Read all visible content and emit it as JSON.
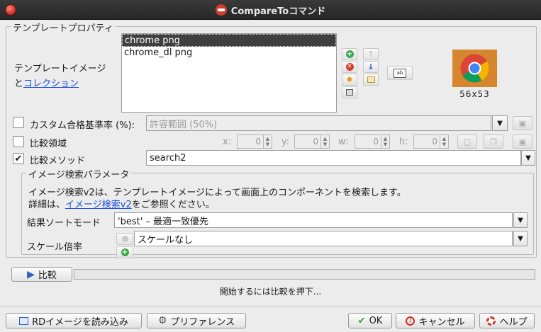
{
  "window": {
    "title": "CompareToコマンド"
  },
  "template_props": {
    "group_title": "テンプレートプロパティ",
    "image_label_prefix": "テンプレートイメージ",
    "image_label_and": "と",
    "collection_link": "コレクション",
    "images": [
      "chrome png",
      "chrome_dl png"
    ],
    "selected_index": 0,
    "preview_size": "56x53"
  },
  "custom_rate": {
    "checked": false,
    "label": "カスタム合格基準率 (%):",
    "placeholder": "許容範囲 (50%)"
  },
  "compare_region": {
    "checked": false,
    "label": "比較領域",
    "x_label": "x:",
    "x": "0",
    "y_label": "y:",
    "y": "0",
    "w_label": "w:",
    "w": "0",
    "h_label": "h:",
    "h": "0"
  },
  "compare_method": {
    "checked": true,
    "label": "比較メソッド",
    "value": "search2"
  },
  "image_search": {
    "group_title": "イメージ検索パラメータ",
    "description": "イメージ検索v2は、テンプレートイメージによって画面上のコンポーネントを検索します。",
    "detail_prefix": "詳細は、",
    "detail_link": "イメージ検索v2",
    "detail_suffix": "をご参照ください。",
    "sort_label": "結果ソートモード",
    "sort_value": "'best' – 最適一致優先",
    "scale_label": "スケール倍率",
    "scale_value": "スケールなし"
  },
  "compare_button": "比較",
  "progress": 0,
  "status_text": "開始するには比較を押下...",
  "footer": {
    "load_rd": "RDイメージを読み込み",
    "preferences": "プリファレンス",
    "ok": "OK",
    "cancel": "キャンセル",
    "help": "ヘルプ"
  },
  "colors": {
    "accent": "#1a4fd8",
    "titlebar": "#2e2e2e",
    "chrome_bg": "#d5862f"
  }
}
